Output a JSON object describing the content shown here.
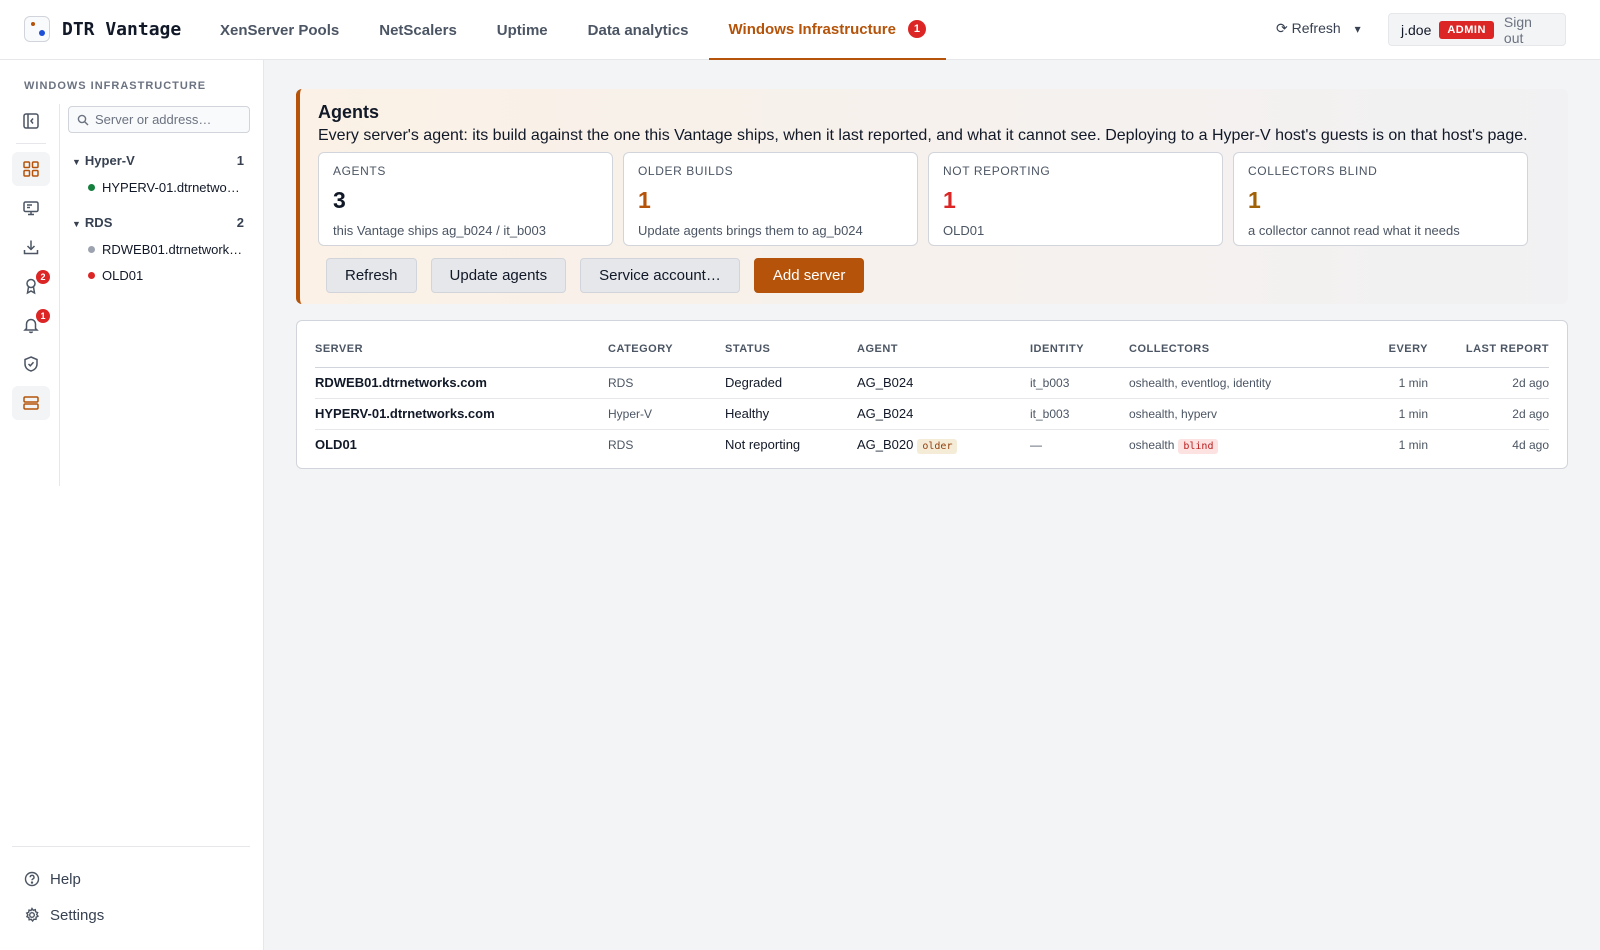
{
  "app": {
    "name": "DTR Vantage"
  },
  "nav": {
    "tabs": [
      {
        "label": "XenServer Pools"
      },
      {
        "label": "NetScalers"
      },
      {
        "label": "Uptime"
      },
      {
        "label": "Data analytics"
      },
      {
        "label": "Windows Infrastructure",
        "badge": "1"
      }
    ],
    "refresh_label": "⟳ Refresh",
    "refresh_caret": "▾"
  },
  "user": {
    "name": "j.doe",
    "role": "ADMIN",
    "signout": "Sign out"
  },
  "sidebar": {
    "title": "WINDOWS INFRASTRUCTURE",
    "search_placeholder": "Server or address…",
    "rail_badges": {
      "awards": "2",
      "alerts": "1"
    },
    "groups": [
      {
        "name": "Hyper-V",
        "count": "1",
        "items": [
          {
            "name": "HYPERV-01.dtrnetworks.com",
            "status_color": "#15803d"
          }
        ]
      },
      {
        "name": "RDS",
        "count": "2",
        "items": [
          {
            "name": "RDWEB01.dtrnetworks.com",
            "status_color": "#9ca3af"
          },
          {
            "name": "OLD01",
            "status_color": "#dc2626"
          }
        ]
      }
    ],
    "footer": {
      "help": "Help",
      "settings": "Settings"
    }
  },
  "agents": {
    "title": "Agents",
    "description": "Every server's agent: its build against the one this Vantage ships, when it last reported, and what it cannot see. Deploying to a Hyper-V host's guests is on that host's page.",
    "stats": [
      {
        "label": "AGENTS",
        "value": "3",
        "sub": "this Vantage ships ag_b024 / it_b003",
        "color": "#111827"
      },
      {
        "label": "OLDER BUILDS",
        "value": "1",
        "sub": "Update agents brings them to ag_b024",
        "color": "#b45309"
      },
      {
        "label": "NOT REPORTING",
        "value": "1",
        "sub": "OLD01",
        "color": "#dc2626"
      },
      {
        "label": "COLLECTORS BLIND",
        "value": "1",
        "sub": "a collector cannot read what it needs",
        "color": "#a16207"
      }
    ],
    "actions": {
      "refresh": "Refresh",
      "update": "Update agents",
      "service": "Service account…",
      "add": "Add server"
    }
  },
  "table": {
    "headers": {
      "server": "SERVER",
      "category": "CATEGORY",
      "status": "STATUS",
      "agent": "AGENT",
      "identity": "IDENTITY",
      "collectors": "COLLECTORS",
      "every": "EVERY",
      "last": "LAST REPORT"
    },
    "rows": [
      {
        "server": "RDWEB01.dtrnetworks.com",
        "category": "RDS",
        "status": "Degraded",
        "agent": "AG_B024",
        "agent_tag": "",
        "identity": "it_b003",
        "collectors": "oshealth, eventlog, identity",
        "collectors_tag": "",
        "every": "1 min",
        "last": "2d ago"
      },
      {
        "server": "HYPERV-01.dtrnetworks.com",
        "category": "Hyper-V",
        "status": "Healthy",
        "agent": "AG_B024",
        "agent_tag": "",
        "identity": "it_b003",
        "collectors": "oshealth, hyperv",
        "collectors_tag": "",
        "every": "1 min",
        "last": "2d ago"
      },
      {
        "server": "OLD01",
        "category": "RDS",
        "status": "Not reporting",
        "agent": "AG_B020",
        "agent_tag": "older",
        "identity": "—",
        "collectors": "oshealth",
        "collectors_tag": "blind",
        "every": "1 min",
        "last": "4d ago"
      }
    ]
  },
  "colors": {
    "accent": "#b45309",
    "danger": "#dc2626"
  }
}
